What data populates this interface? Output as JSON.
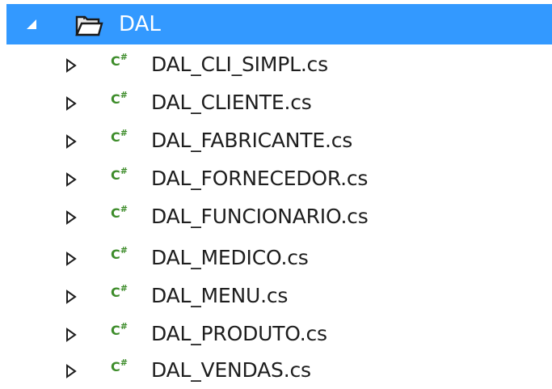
{
  "tree": {
    "folder": {
      "label": "DAL",
      "expanded": true,
      "icon": "folder-open-icon",
      "selected_color": "#3399ff"
    },
    "items": [
      {
        "label": "DAL_CLI_SIMPL.cs",
        "icon": "csharp-file-icon",
        "badge": "C#"
      },
      {
        "label": "DAL_CLIENTE.cs",
        "icon": "csharp-file-icon",
        "badge": "C#"
      },
      {
        "label": "DAL_FABRICANTE.cs",
        "icon": "csharp-file-icon",
        "badge": "C#"
      },
      {
        "label": "DAL_FORNECEDOR.cs",
        "icon": "csharp-file-icon",
        "badge": "C#"
      },
      {
        "label": "DAL_FUNCIONARIO.cs",
        "icon": "csharp-file-icon",
        "badge": "C#"
      },
      {
        "label": "DAL_MEDICO.cs",
        "icon": "csharp-file-icon",
        "badge": "C#"
      },
      {
        "label": "DAL_MENU.cs",
        "icon": "csharp-file-icon",
        "badge": "C#"
      },
      {
        "label": "DAL_PRODUTO.cs",
        "icon": "csharp-file-icon",
        "badge": "C#"
      },
      {
        "label": "DAL_VENDAS.cs",
        "icon": "csharp-file-icon",
        "badge": "C#"
      }
    ],
    "badge_color": "#3d8c2a"
  }
}
